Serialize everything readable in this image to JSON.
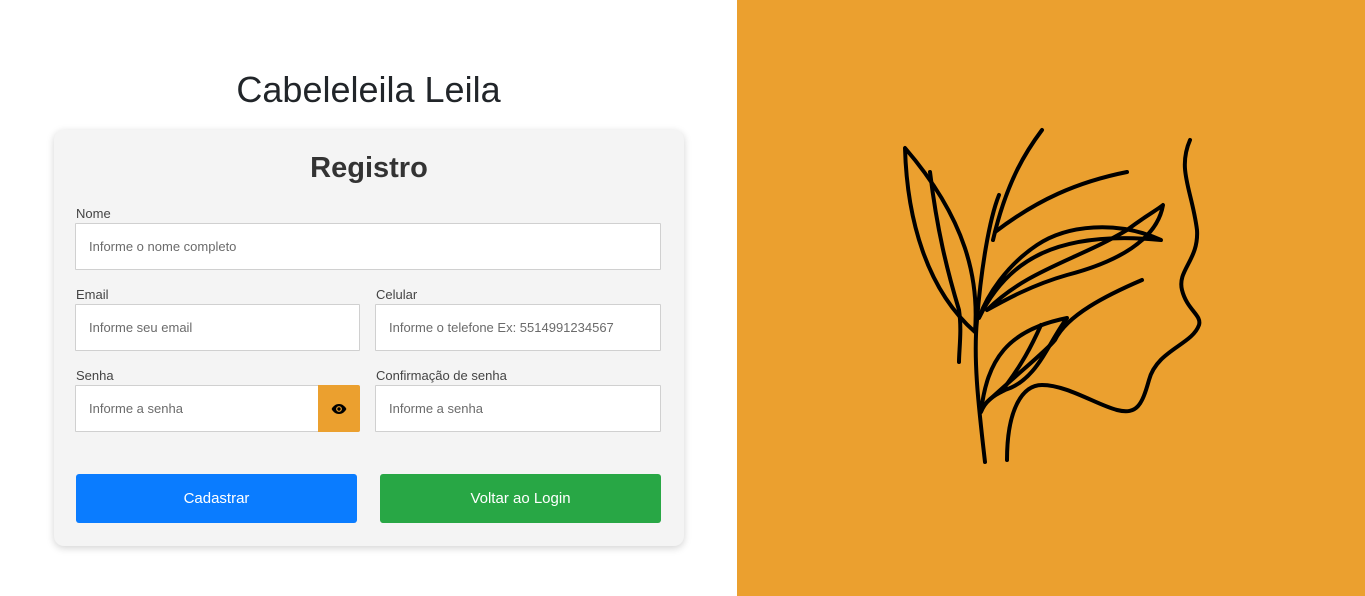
{
  "header": {
    "title": "Cabeleleila Leila"
  },
  "form": {
    "title": "Registro",
    "nome": {
      "label": "Nome",
      "placeholder": "Informe o nome completo",
      "value": ""
    },
    "email": {
      "label": "Email",
      "placeholder": "Informe seu email",
      "value": ""
    },
    "celular": {
      "label": "Celular",
      "placeholder": "Informe o telefone Ex: 5514991234567",
      "value": ""
    },
    "senha": {
      "label": "Senha",
      "placeholder": "Informe a senha",
      "value": ""
    },
    "confirmacao": {
      "label": "Confirmação de senha",
      "placeholder": "Informe a senha",
      "value": ""
    },
    "toggle_icon": "eye-icon",
    "cadastrar_label": "Cadastrar",
    "voltar_label": "Voltar ao Login"
  },
  "theme": {
    "accent": "#eba02f",
    "primary": "#0a7cff",
    "success": "#28a745",
    "card": "#f4f4f4"
  }
}
